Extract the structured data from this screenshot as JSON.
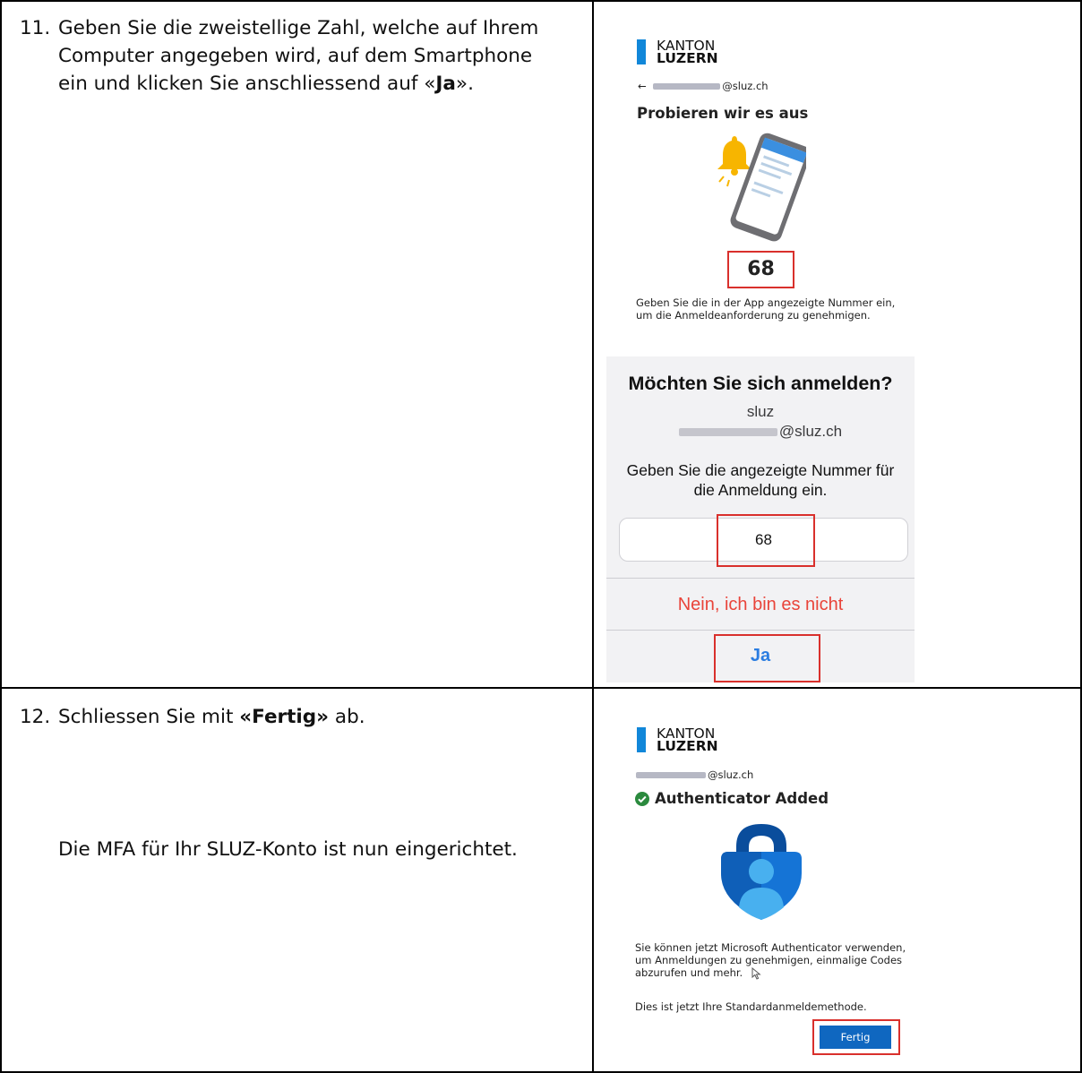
{
  "step11": {
    "number": "11.",
    "line1": "Geben Sie die zweistellige Zahl, welche auf Ihrem",
    "line2": "Computer angegeben wird, auf dem Smartphone",
    "line3_pre": "ein und klicken Sie anschliessend auf «",
    "line3_bold": "Ja",
    "line3_post": "»."
  },
  "step12": {
    "number": "12.",
    "pre": "Schliessen Sie mit ",
    "bold": "«Fertig»",
    "post": " ab.",
    "note": "Die MFA für Ihr SLUZ-Konto ist nun eingerichtet."
  },
  "logo": {
    "line1": "KANTON",
    "line2": "LUZERN"
  },
  "screen1": {
    "back_arrow": "←",
    "account_suffix": "@sluz.ch",
    "heading": "Probieren wir es aus",
    "number": "68",
    "caption_l1": "Geben Sie die in der App angezeigte Nummer ein,",
    "caption_l2": "um die Anmeldeanforderung zu genehmigen."
  },
  "phone": {
    "title": "Möchten Sie sich anmelden?",
    "org": "sluz",
    "account_suffix": "@sluz.ch",
    "prompt_l1": "Geben Sie die angezeigte Nummer für",
    "prompt_l2": "die Anmeldung ein.",
    "input_value": "68",
    "deny_label": "Nein, ich bin es nicht",
    "confirm_label": "Ja"
  },
  "screen2": {
    "account_suffix": "@sluz.ch",
    "heading": "Authenticator Added",
    "body_l1": "Sie können jetzt Microsoft Authenticator verwenden,",
    "body_l2": "um Anmeldungen zu genehmigen, einmalige Codes",
    "body_l3": "abzurufen und mehr.",
    "default_note": "Dies ist jetzt Ihre Standardanmeldemethode.",
    "done_label": "Fertig"
  },
  "colors": {
    "brand_blue": "#1187d9",
    "highlight_red": "#d9302c",
    "button_blue": "#0f67c0",
    "ios_red": "#e9443a",
    "ios_blue": "#2b7de1"
  },
  "icons": [
    "arrow-left-icon",
    "bell-icon",
    "phone-illustration-icon",
    "check-circle-icon",
    "authenticator-lock-icon",
    "cursor-icon"
  ]
}
